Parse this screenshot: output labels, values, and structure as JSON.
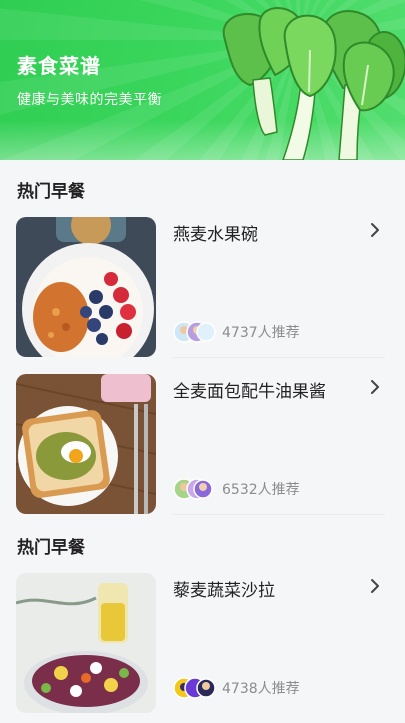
{
  "banner": {
    "title": "素食菜谱",
    "subtitle": "健康与美味的完美平衡"
  },
  "sections": [
    {
      "title": "热门早餐",
      "items": [
        {
          "name": "燕麦水果碗",
          "recommend": "4737人推荐",
          "image": "oatmeal-fruit-bowl-photo"
        },
        {
          "name": "全麦面包配牛油果酱",
          "recommend": "6532人推荐",
          "image": "avocado-toast-photo"
        }
      ]
    },
    {
      "title": "热门早餐",
      "items": [
        {
          "name": "藜麦蔬菜沙拉",
          "recommend": "4738人推荐",
          "image": "quinoa-salad-photo"
        }
      ]
    }
  ],
  "icons": {
    "chevron": "chevron-right-icon",
    "avatars": "user-avatars-icon"
  },
  "colors": {
    "brand_green": "#2fce52",
    "text_primary": "#222222",
    "text_secondary": "#8c8c8c"
  }
}
